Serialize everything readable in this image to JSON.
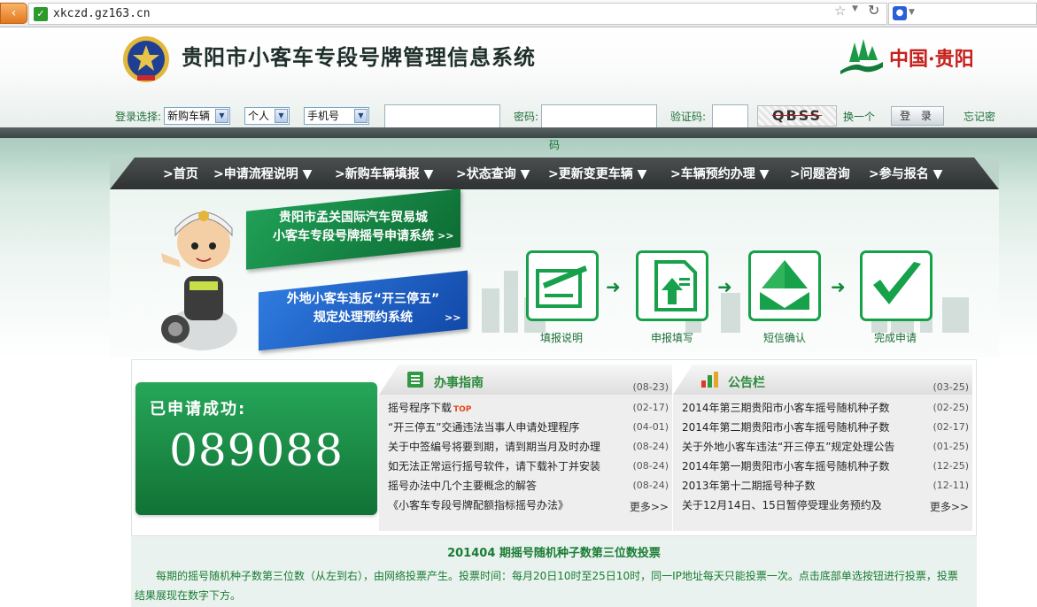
{
  "browser": {
    "url": "xkczd.gz163.cn"
  },
  "header": {
    "title": "贵阳市小客车专段号牌管理信息系统",
    "logo_text": "中国·贵阳"
  },
  "login": {
    "select_label": "登录选择:",
    "vehicle_type": "新购车辆",
    "person_type": "个人",
    "id_type": "手机号",
    "password_label": "密码:",
    "captcha_label": "验证码:",
    "captcha_text": "QBSS",
    "refresh_label": "换一个",
    "login_button": "登 录",
    "forget_label_1": "忘记密",
    "forget_label_2": "码"
  },
  "nav": {
    "items": [
      {
        "label": ">首页"
      },
      {
        "label": ">申请流程说明 ▼"
      },
      {
        "label": ">新购车辆填报 ▼"
      },
      {
        "label": ">状态查询 ▼"
      },
      {
        "label": ">更新变更车辆 ▼"
      },
      {
        "label": ">车辆预约办理 ▼"
      },
      {
        "label": ">问题咨询"
      },
      {
        "label": ">参与报名 ▼"
      }
    ]
  },
  "promos": {
    "green_line1": "贵阳市孟关国际汽车贸易城",
    "green_line2": "小客车专段号牌摇号申请系统",
    "blue_line1": "外地小客车违反“开三停五”",
    "blue_line2": "规定处理预约系统",
    "arrows": ">>"
  },
  "steps": [
    {
      "label": "填报说明"
    },
    {
      "label": "申报填写"
    },
    {
      "label": "短信确认"
    },
    {
      "label": "完成申请"
    }
  ],
  "success": {
    "label": "已申请成功:",
    "number": "089088"
  },
  "guide": {
    "title": "办事指南",
    "header_date": "(08-23)",
    "items": [
      {
        "text": "摇号程序下载",
        "tag": "TOP",
        "date": "(02-17)"
      },
      {
        "text": "“开三停五”交通违法当事人申请处理程序",
        "date": "(04-01)"
      },
      {
        "text": "关于中签编号将要到期，请到期当月及时办理",
        "date": "(08-24)"
      },
      {
        "text": "如无法正常运行摇号软件，请下载补丁并安装",
        "date": "(08-24)"
      },
      {
        "text": "摇号办法中几个主要概念的解答",
        "date": "(08-24)"
      },
      {
        "text": "《小客车专段号牌配额指标摇号办法》",
        "date": ""
      }
    ],
    "more": "更多>>"
  },
  "notice": {
    "title": "公告栏",
    "header_date": "(03-25)",
    "items": [
      {
        "text": "2014年第三期贵阳市小客车摇号随机种子数",
        "date": "(02-25)"
      },
      {
        "text": "2014年第二期贵阳市小客车摇号随机种子数",
        "date": "(02-17)"
      },
      {
        "text": "关于外地小客车违法“开三停五”规定处理公告",
        "date": "(01-25)"
      },
      {
        "text": "2014年第一期贵阳市小客车摇号随机种子数",
        "date": "(12-25)"
      },
      {
        "text": "2013年第十二期摇号种子数",
        "date": "(12-11)"
      },
      {
        "text": "关于12月14日、15日暂停受理业务预约及",
        "date": ""
      }
    ],
    "more": "更多>>"
  },
  "vote": {
    "title": "201404 期摇号随机种子数第三位数投票",
    "text": "每期的摇号随机种子数第三位数（从左到右），由网络投票产生。投票时间：每月20日10时至25日10时，同一IP地址每天只能投票一次。点击底部单选按钮进行投票，投票结果展现在数字下方。"
  },
  "colors": {
    "brand_green": "#17a14a",
    "nav_dark": "#3a3e3f",
    "promo_blue": "#1f62c9",
    "logo_red": "#c6201c"
  }
}
